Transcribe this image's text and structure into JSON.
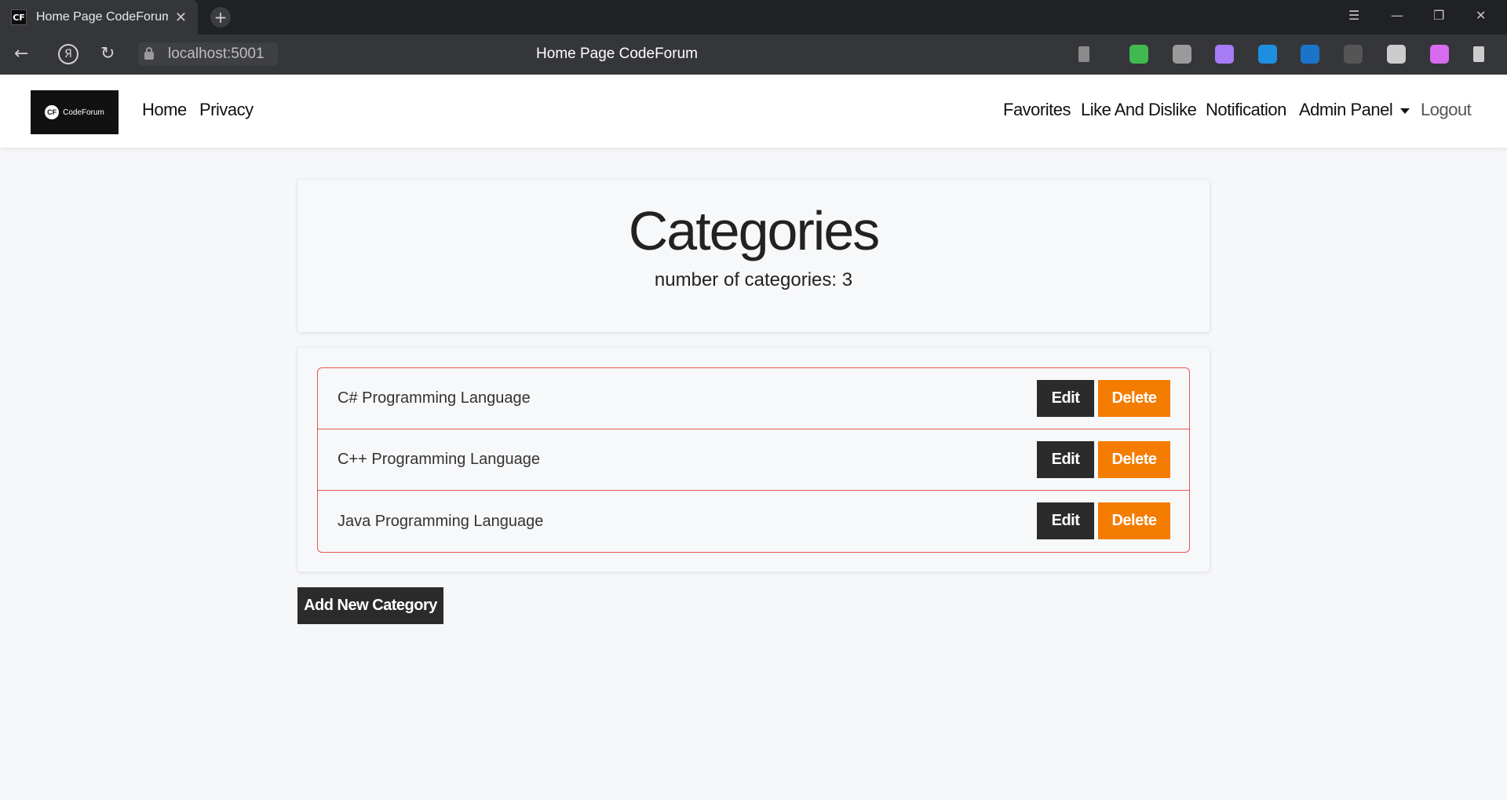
{
  "browser": {
    "tab_favicon": "CF",
    "tab_title": "Home Page CodeForum",
    "tab_close": "✕",
    "new_tab": "+",
    "url": "localhost:5001",
    "page_title": "Home Page CodeForum",
    "window_controls": {
      "menu": "☰",
      "minimize": "—",
      "restore": "❐",
      "close": "✕"
    },
    "nav_icons": {
      "back": "←",
      "yandex": "Я",
      "reload": "↻"
    },
    "extensions": [
      {
        "name": "bookmark-icon",
        "color": "#8a8a8a"
      },
      {
        "name": "shield-check-icon",
        "color": "#3fb950"
      },
      {
        "name": "shield-gray-icon",
        "color": "#9a9a9a"
      },
      {
        "name": "feather-icon",
        "color": "#a67bf5"
      },
      {
        "name": "s-extension-icon",
        "color": "#1e8fe0"
      },
      {
        "name": "x-extension-icon",
        "color": "#1b74c9"
      },
      {
        "name": "cube-icon",
        "color": "#555555"
      },
      {
        "name": "angular-icon",
        "color": "#cccccc"
      },
      {
        "name": "pink-extension-icon",
        "color": "#d76cf0"
      },
      {
        "name": "download-icon",
        "color": "#cccccc"
      }
    ]
  },
  "navbar": {
    "logo_mark": "CF",
    "logo_text": "CodeForum",
    "left_links": [
      "Home",
      "Privacy"
    ],
    "right_links": [
      "Favorites",
      "Like And Dislike",
      "Notification"
    ],
    "admin_panel": "Admin Panel",
    "logout": "Logout"
  },
  "header": {
    "title": "Categories",
    "count_label": "number of categories: 3"
  },
  "categories": [
    {
      "name": "C# Programming Language",
      "edit_label": "Edit",
      "delete_label": "Delete"
    },
    {
      "name": "C++ Programming Language",
      "edit_label": "Edit",
      "delete_label": "Delete"
    },
    {
      "name": "Java Programming Language",
      "edit_label": "Edit",
      "delete_label": "Delete"
    }
  ],
  "add_button": "Add New Category",
  "colors": {
    "accent_orange": "#f47c00",
    "dark_button": "#2b2b2b",
    "list_border": "#e0584c"
  }
}
